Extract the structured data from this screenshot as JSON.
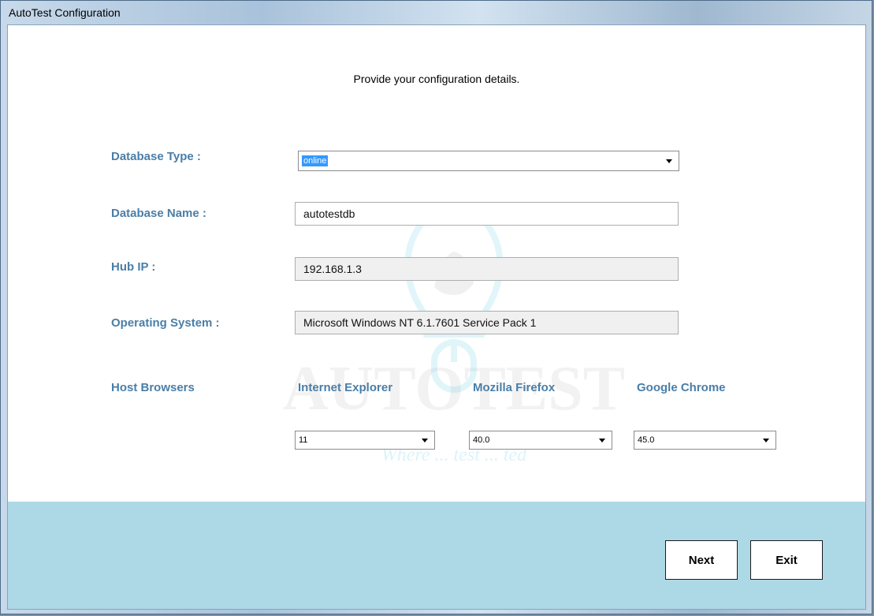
{
  "window": {
    "title": "AutoTest Configuration"
  },
  "header": {
    "instruction": "Provide your configuration details."
  },
  "form": {
    "database_type": {
      "label": "Database Type :",
      "value": "online"
    },
    "database_name": {
      "label": "Database Name :",
      "value": "autotestdb"
    },
    "hub_ip": {
      "label": "Hub IP :",
      "value": "192.168.1.3"
    },
    "operating_system": {
      "label": "Operating System :",
      "value": "Microsoft Windows NT 6.1.7601 Service Pack 1"
    }
  },
  "browsers": {
    "section_label": "Host Browsers",
    "internet_explorer": {
      "label": "Internet Explorer",
      "version": "11"
    },
    "firefox": {
      "label": "Mozilla Firefox",
      "version": "40.0"
    },
    "chrome": {
      "label": "Google Chrome",
      "version": "45.0"
    }
  },
  "watermark": {
    "brand": "AUTOTEST",
    "tagline": "Where ... test ... ted"
  },
  "buttons": {
    "next": "Next",
    "exit": "Exit"
  },
  "colors": {
    "label_blue": "#4a7ea7",
    "footer_bg": "#add8e6",
    "selection": "#3399ff"
  }
}
